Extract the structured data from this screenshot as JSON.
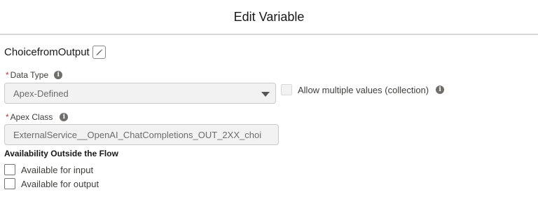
{
  "modal": {
    "title": "Edit Variable"
  },
  "variable": {
    "api_name": "ChoicefromOutput"
  },
  "data_type": {
    "label": "Data Type",
    "required_marker": "*",
    "value": "Apex-Defined",
    "multiple_label": "Allow multiple values (collection)"
  },
  "apex_class": {
    "label": "Apex Class",
    "required_marker": "*",
    "value": "ExternalService__OpenAI_ChatCompletions_OUT_2XX_choi"
  },
  "availability": {
    "title": "Availability Outside the Flow",
    "input_label": "Available for input",
    "output_label": "Available for output"
  },
  "icons": {
    "info": "info-icon",
    "edit": "pencil-icon",
    "caret": "chevron-down-icon"
  }
}
